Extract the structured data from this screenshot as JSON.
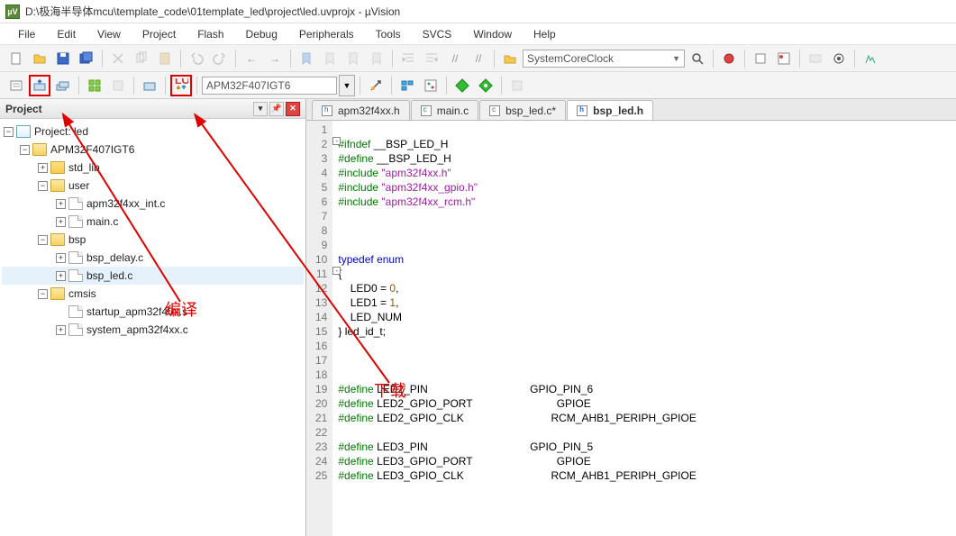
{
  "title": "D:\\极海半导体mcu\\template_code\\01template_led\\project\\led.uvprojx - µVision",
  "menu": [
    "File",
    "Edit",
    "View",
    "Project",
    "Flash",
    "Debug",
    "Peripherals",
    "Tools",
    "SVCS",
    "Window",
    "Help"
  ],
  "toolbar1": {
    "quickbox": "SystemCoreClock"
  },
  "toolbar2": {
    "target": "APM32F407IGT6"
  },
  "panel": {
    "title": "Project"
  },
  "tree": {
    "root": "Project: led",
    "target": "APM32F407IGT6",
    "groups": {
      "std_lib": "std_lib",
      "user": "user",
      "user_files": [
        "apm32f4xx_int.c",
        "main.c"
      ],
      "bsp": "bsp",
      "bsp_files": [
        "bsp_delay.c",
        "bsp_led.c"
      ],
      "cmsis": "cmsis",
      "cmsis_files": [
        "startup_apm32f40x.s",
        "system_apm32f4xx.c"
      ]
    }
  },
  "tabs": [
    {
      "label": "apm32f4xx.h",
      "kind": "h",
      "active": false
    },
    {
      "label": "main.c",
      "kind": "c",
      "active": false
    },
    {
      "label": "bsp_led.c*",
      "kind": "c",
      "active": false
    },
    {
      "label": "bsp_led.h",
      "kind": "h",
      "active": true
    }
  ],
  "code": {
    "lines": [
      {
        "n": 1,
        "html": ""
      },
      {
        "n": 2,
        "html": "<span class='pp'>#ifndef</span> __BSP_LED_H",
        "fold": "-"
      },
      {
        "n": 3,
        "html": "<span class='pp'>#define</span> __BSP_LED_H"
      },
      {
        "n": 4,
        "html": "<span class='pp'>#include</span> <span class='str'>\"apm32f4xx.h\"</span>"
      },
      {
        "n": 5,
        "html": "<span class='pp'>#include</span> <span class='str'>\"apm32f4xx_gpio.h\"</span>"
      },
      {
        "n": 6,
        "html": "<span class='pp'>#include</span> <span class='str'>\"apm32f4xx_rcm.h\"</span>"
      },
      {
        "n": 7,
        "html": ""
      },
      {
        "n": 8,
        "html": ""
      },
      {
        "n": 9,
        "html": ""
      },
      {
        "n": 10,
        "html": "<span class='kw'>typedef</span> <span class='kw'>enum</span>"
      },
      {
        "n": 11,
        "html": "{",
        "fold": "-"
      },
      {
        "n": 12,
        "html": "    LED0 = <span class='num'>0</span>,"
      },
      {
        "n": 13,
        "html": "    LED1 = <span class='num'>1</span>,"
      },
      {
        "n": 14,
        "html": "    LED_NUM"
      },
      {
        "n": 15,
        "html": "} led_id_t;"
      },
      {
        "n": 16,
        "html": ""
      },
      {
        "n": 17,
        "html": ""
      },
      {
        "n": 18,
        "html": ""
      },
      {
        "n": 19,
        "html": "<span class='pp'>#define</span> LED2_PIN                                  GPIO_PIN_6"
      },
      {
        "n": 20,
        "html": "<span class='pp'>#define</span> LED2_GPIO_PORT                            GPIOE"
      },
      {
        "n": 21,
        "html": "<span class='pp'>#define</span> LED2_GPIO_CLK                             RCM_AHB1_PERIPH_GPIOE"
      },
      {
        "n": 22,
        "html": ""
      },
      {
        "n": 23,
        "html": "<span class='pp'>#define</span> LED3_PIN                                  GPIO_PIN_5"
      },
      {
        "n": 24,
        "html": "<span class='pp'>#define</span> LED3_GPIO_PORT                            GPIOE"
      },
      {
        "n": 25,
        "html": "<span class='pp'>#define</span> LED3_GPIO_CLK                             RCM_AHB1_PERIPH_GPIOE"
      }
    ]
  },
  "annotations": {
    "compile": "编译",
    "download": "下载"
  }
}
